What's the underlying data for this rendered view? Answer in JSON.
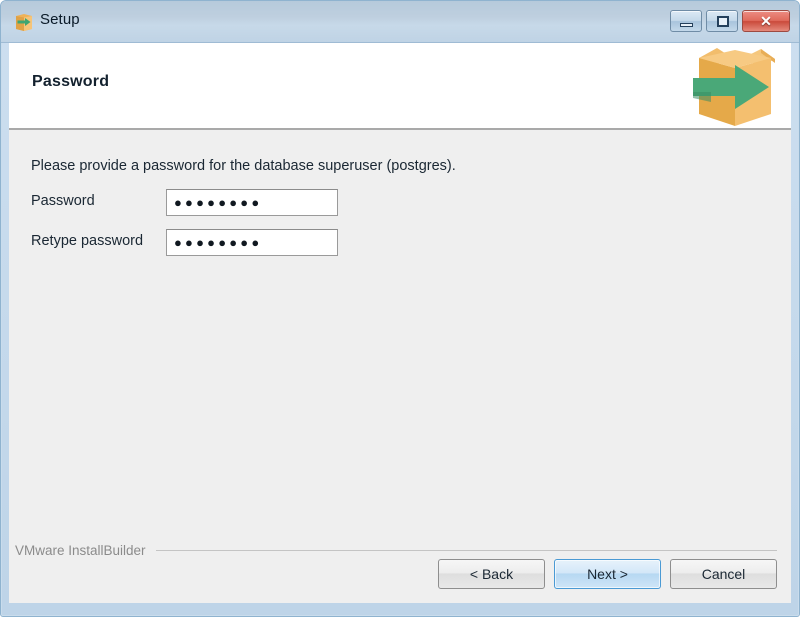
{
  "window": {
    "title": "Setup",
    "icon": "installer-box-icon",
    "controls": {
      "minimize_label": "Minimize",
      "maximize_label": "Maximize",
      "close_label": "✕"
    }
  },
  "header": {
    "title": "Password",
    "logo": "installbuilder-box-arrow-logo"
  },
  "main": {
    "instruction": "Please provide a password for the database superuser (postgres).",
    "fields": [
      {
        "label": "Password",
        "value": "●●●●●●●●",
        "placeholder": ""
      },
      {
        "label": "Retype password",
        "value": "●●●●●●●●",
        "placeholder": ""
      }
    ]
  },
  "footer": {
    "brand": "VMware InstallBuilder",
    "buttons": {
      "back": "< Back",
      "next": "Next >",
      "cancel": "Cancel"
    }
  },
  "colors": {
    "titlebar_top": "#b6cadb",
    "titlebar_bottom": "#bfd3e5",
    "window_border": "#8fb3cf",
    "content_bg": "#efefef",
    "header_bg": "#ffffff",
    "logo_box": "#f0b860",
    "logo_arrow": "#4aa878",
    "default_button_border": "#4a9ad4",
    "close_button": "#ca4a3b",
    "brand_text": "#8b8b8b"
  }
}
